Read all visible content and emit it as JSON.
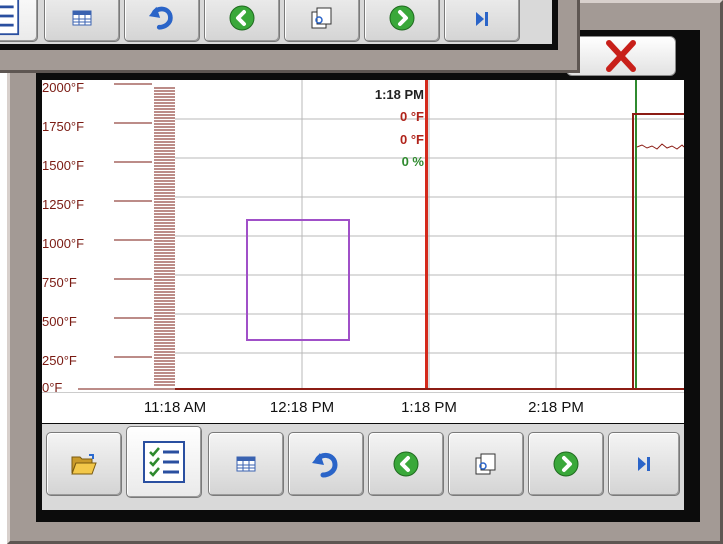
{
  "window": {
    "close_icon": "close-x-icon",
    "accent_red": "#c8201a",
    "frame_color": "#a39a95"
  },
  "chart": {
    "y_ticks": [
      "2000°F",
      "1750°F",
      "1500°F",
      "1250°F",
      "1000°F",
      "750°F",
      "500°F",
      "250°F",
      "0°F"
    ],
    "x_ticks": [
      "11:18 AM",
      "12:18 PM",
      "1:18 PM",
      "2:18 PM"
    ],
    "cursor": {
      "time": "1:18 PM",
      "value_1": "0 °F",
      "value_2": "0 °F",
      "value_3": "0 %",
      "color_time": "#222222",
      "color_temp": "#b0231a",
      "color_pct": "#2f8a2f"
    },
    "grid_color": "#b8b8b8",
    "selection_color": "#a050c8"
  },
  "chart_data": {
    "type": "line",
    "x": [
      "11:18 AM",
      "12:18 PM",
      "1:18 PM",
      "2:18 PM"
    ],
    "y_ticks": [
      "2000°F",
      "1750°F",
      "1500°F",
      "1250°F",
      "1000°F",
      "750°F",
      "500°F",
      "250°F",
      "0°F"
    ],
    "ylim": [
      0,
      2000
    ],
    "cursor_readout": [
      "1:18 PM",
      "0 °F",
      "0 °F",
      "0 %"
    ]
  },
  "toolbar": {
    "buttons": [
      {
        "icon": "open-folder-icon"
      },
      {
        "icon": "checklist-icon"
      },
      {
        "icon": "table-icon"
      },
      {
        "icon": "undo-icon"
      },
      {
        "icon": "back-arrow-icon"
      },
      {
        "icon": "snapshot-icon"
      },
      {
        "icon": "forward-arrow-icon"
      },
      {
        "icon": "skip-to-end-icon"
      }
    ]
  }
}
